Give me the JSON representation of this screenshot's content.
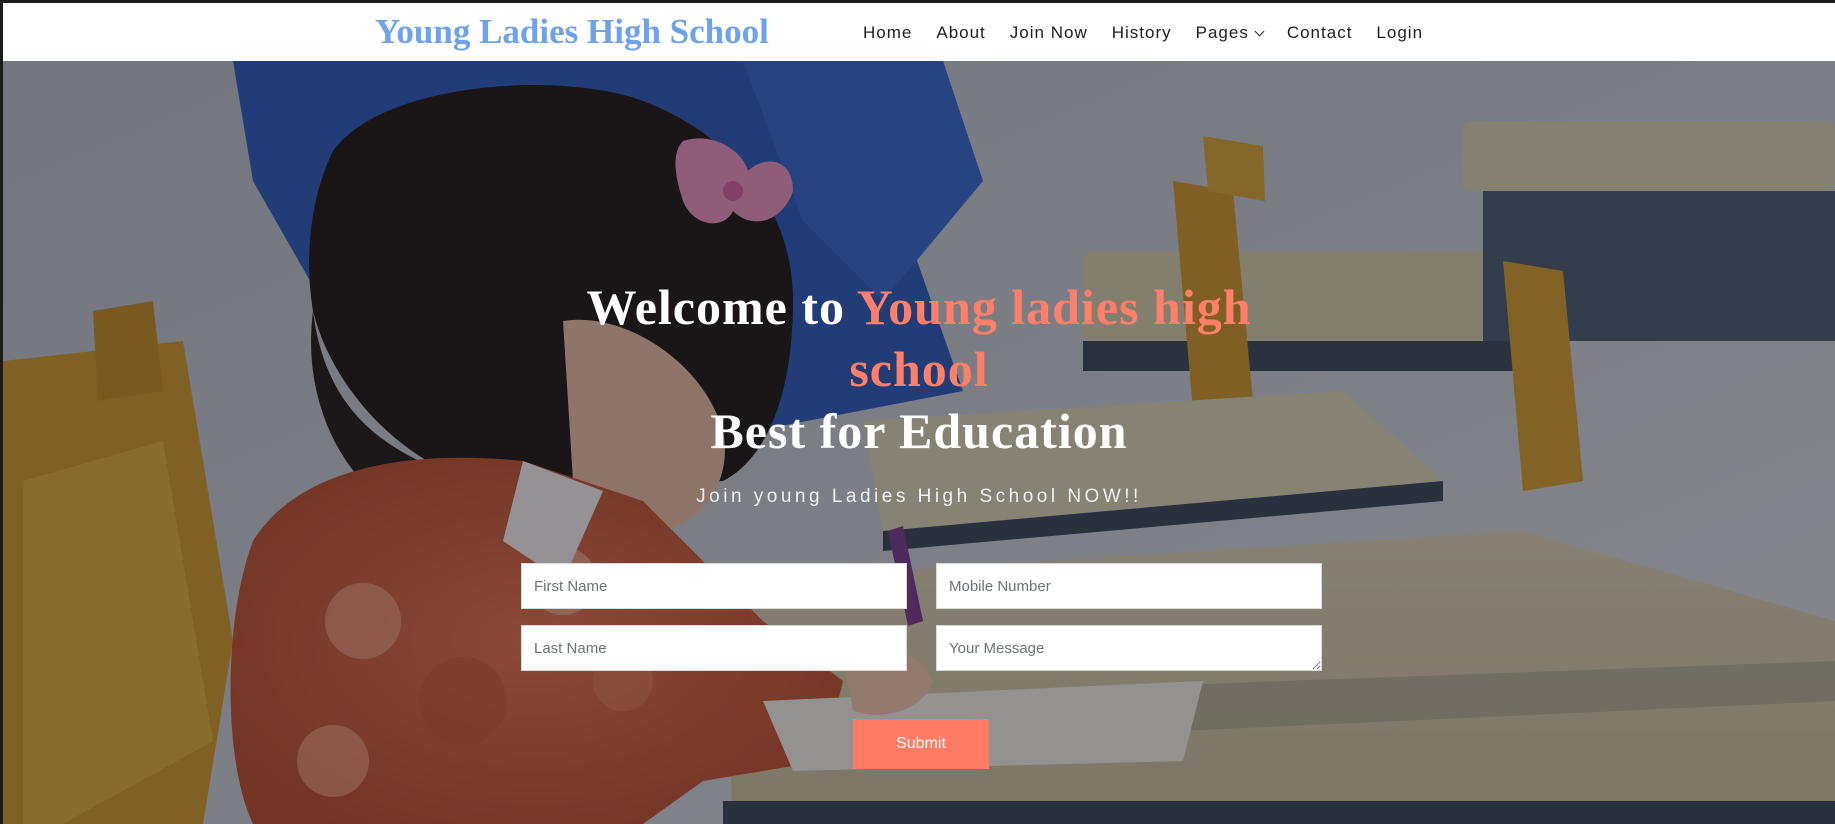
{
  "header": {
    "brand": "Young Ladies High School",
    "nav": [
      "Home",
      "About",
      "Join Now",
      "History",
      "Pages",
      "Contact",
      "Login"
    ],
    "pages_icon": "chevron-down-icon"
  },
  "hero": {
    "title_prefix": "Welcome to ",
    "title_accent_1": "Young ladies high",
    "title_accent_2": "school",
    "title_line_3": "Best for Education",
    "subtitle": "Join young Ladies High School NOW!!",
    "background": "classroom photo: young girl writing at desk",
    "form": {
      "first_name_placeholder": "First Name",
      "last_name_placeholder": "Last Name",
      "mobile_placeholder": "Mobile Number",
      "message_placeholder": "Your Message",
      "submit_label": "Submit"
    }
  },
  "colors": {
    "brand": "#6ea2ea",
    "accent": "#ff7f69",
    "button": "#ff7b63"
  }
}
